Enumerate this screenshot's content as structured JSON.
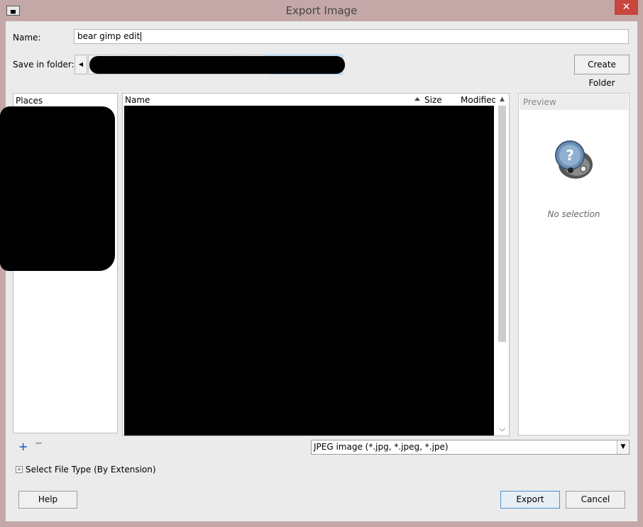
{
  "window": {
    "title": "Export Image",
    "close_glyph": "✕",
    "app_icon": "gimp-icon"
  },
  "name_row": {
    "label": "Name:",
    "value": "bear gimp edit"
  },
  "folder_row": {
    "label": "Save in folder:",
    "back_glyph": "◀",
    "create_folder_label": "Create Folder"
  },
  "places": {
    "header": "Places",
    "add_glyph": "+",
    "remove_glyph": "−"
  },
  "files": {
    "col_name": "Name",
    "col_size": "Size",
    "col_modified": "Modified",
    "scroll_up": "▲",
    "scroll_down": "⌵"
  },
  "preview": {
    "header": "Preview",
    "empty_text": "No selection",
    "icon": "question-mark-gimp-icon"
  },
  "filetype": {
    "value": "JPEG image (*.jpg, *.jpeg, *.jpe)",
    "dropdown_glyph": "▼"
  },
  "select_type": {
    "expander_glyph": "+",
    "label": "Select File Type (By Extension)"
  },
  "buttons": {
    "help": "Help",
    "export": "Export",
    "cancel": "Cancel"
  },
  "colors": {
    "frame": "#c4a8a8",
    "close": "#c7463d",
    "accent": "#3b79c2"
  }
}
